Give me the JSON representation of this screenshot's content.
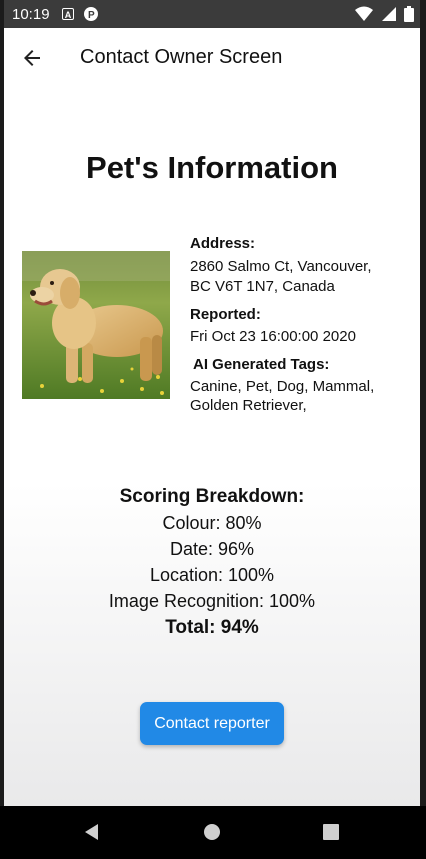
{
  "status_bar": {
    "time": "10:19",
    "notification_icons": [
      "a-badge-icon",
      "p-circle-icon"
    ],
    "right_icons": [
      "wifi-icon",
      "signal-icon",
      "battery-icon"
    ]
  },
  "app_bar": {
    "title": "Contact Owner Screen",
    "back_icon": "arrow-left-icon"
  },
  "pet_info": {
    "heading": "Pet's Information",
    "photo_icon": "golden-retriever-photo",
    "address_label": "Address:",
    "address_line1": "2860 Salmo Ct, Vancouver,",
    "address_line2": "BC V6T 1N7, Canada",
    "reported_label": "Reported:",
    "reported_value": "Fri Oct 23 16:00:00 2020",
    "tags_label": "AI Generated Tags:",
    "tags_line1": "Canine, Pet, Dog, Mammal,",
    "tags_line2": "Golden Retriever,"
  },
  "scoring": {
    "title": "Scoring Breakdown:",
    "colour": "Colour: 80%",
    "date": "Date: 96%",
    "location": "Location: 100%",
    "image_recognition": "Image Recognition: 100%",
    "total": "Total: 94%"
  },
  "contact_button": {
    "label": "Contact reporter",
    "color": "#2189e6"
  },
  "nav_bar": {
    "icons": [
      "nav-back-icon",
      "nav-home-icon",
      "nav-recents-icon"
    ]
  }
}
